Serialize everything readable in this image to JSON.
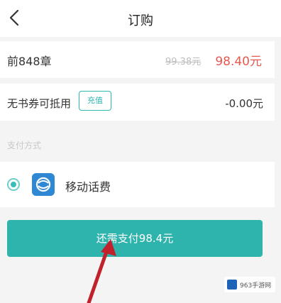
{
  "header": {
    "title": "订购"
  },
  "order": {
    "chapter_label": "前848章",
    "original_price": "99.38元",
    "price": "98.40元"
  },
  "coupon": {
    "label": "无书券可抵用",
    "recharge_label": "充值",
    "value": "-0.00元"
  },
  "payment": {
    "section_label": "支付方式",
    "method_label": "移动话费",
    "method_icon": "china-mobile-icon",
    "selected": true
  },
  "action": {
    "pay_button_label": "还需支付98.4元"
  },
  "watermark": {
    "text": "963手游网"
  },
  "colors": {
    "accent": "#2fb3ad",
    "price": "#e8584f",
    "annotation_arrow": "#c0212c"
  }
}
